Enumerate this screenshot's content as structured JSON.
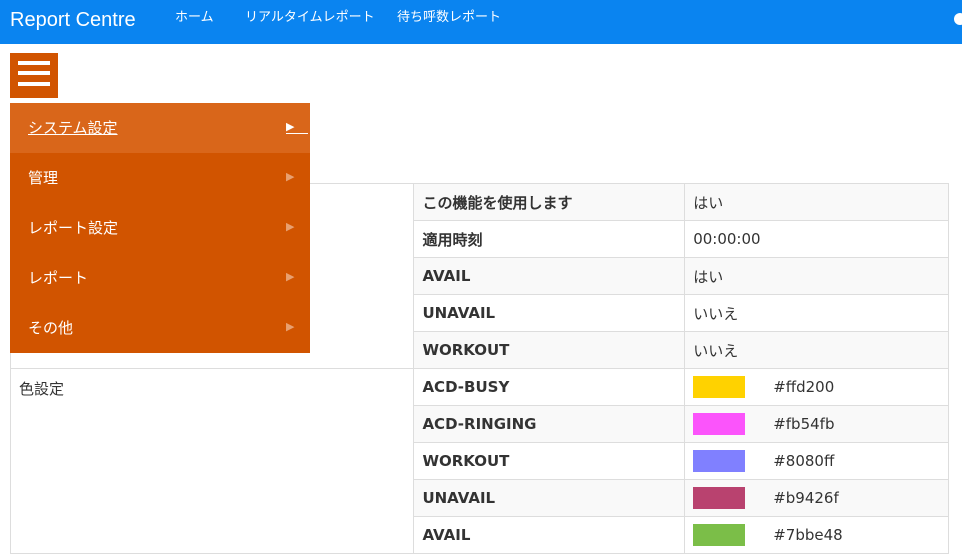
{
  "app": {
    "title": "Report Centre"
  },
  "nav": {
    "home": "ホーム",
    "realtime_report": "リアルタイムレポート",
    "queue_report": "待ち呼数レポート"
  },
  "menu": {
    "items": [
      {
        "label": "システム設定",
        "active": true
      },
      {
        "label": "管理",
        "active": false
      },
      {
        "label": "レポート設定",
        "active": false
      },
      {
        "label": "レポート",
        "active": false
      },
      {
        "label": "その他",
        "active": false
      }
    ],
    "arrow_glyph": "▶"
  },
  "settings": {
    "rows": [
      {
        "key": "この機能を使用します",
        "value": "はい"
      },
      {
        "key": "適用時刻",
        "value": "00:00:00"
      },
      {
        "key": "AVAIL",
        "value": "はい"
      },
      {
        "key": "UNAVAIL",
        "value": "いいえ"
      },
      {
        "key": "WORKOUT",
        "value": "いいえ"
      }
    ]
  },
  "color_settings": {
    "section_label": "色設定",
    "rows": [
      {
        "key": "ACD-BUSY",
        "hex": "#ffd200",
        "color": "#ffd200"
      },
      {
        "key": "ACD-RINGING",
        "hex": "#fb54fb",
        "color": "#fb54fb"
      },
      {
        "key": "WORKOUT",
        "hex": "#8080ff",
        "color": "#8080ff"
      },
      {
        "key": "UNAVAIL",
        "hex": "#b9426f",
        "color": "#b9426f"
      },
      {
        "key": "AVAIL",
        "hex": "#7bbe48",
        "color": "#7bbe48"
      }
    ]
  },
  "colors": {
    "navbar": "#0a84f0",
    "menu": "#d15400",
    "menu_active": "#d9661a"
  }
}
